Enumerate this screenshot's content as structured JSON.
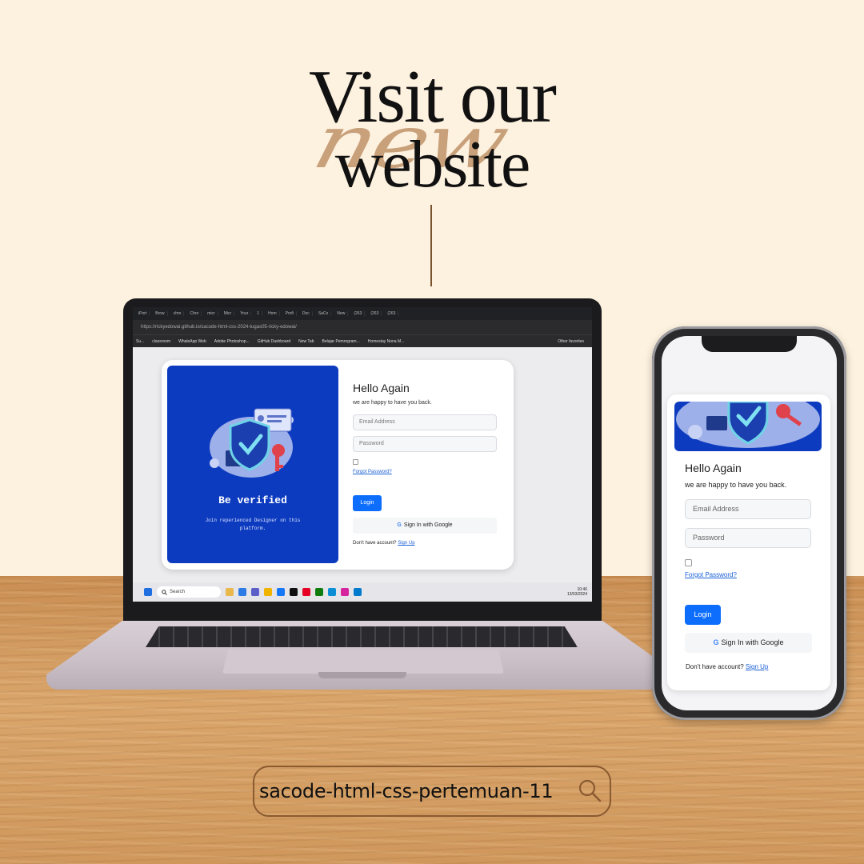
{
  "headline": {
    "script_word": "new",
    "line1": "Visit our",
    "line2": "website"
  },
  "browser": {
    "tabs": [
      "iPort",
      "Brow",
      "chro",
      "Chro",
      "micr",
      "Micr",
      "Your",
      "1",
      "Hom",
      "Profi",
      "Doc",
      "SaCo",
      "New",
      "(263",
      "(263",
      "(263"
    ],
    "url": "https://rickyedowai.github.io/sacode-html-css-2024-tugas05-ricky-edowai/",
    "bookmarks": [
      "Su...",
      "classroom",
      "WhatsApp Web",
      "Adobe Photoshop...",
      "GitHub Dashboard",
      "New Tab",
      "Belajar Pemrogram...",
      "Homestay Nona M..."
    ],
    "other_favorites": "Other favorites"
  },
  "taskbar": {
    "search": "Search",
    "time": "10:46",
    "date": "13/03/2024"
  },
  "laptop_card": {
    "panel_title": "Be verified",
    "panel_text": "Join reperienced Designer on this platform.",
    "title": "Hello Again",
    "subtitle": "we are happy to have you back.",
    "email_placeholder": "Email Address",
    "password_placeholder": "Password",
    "forgot": "Forgot Password?",
    "login": "Login",
    "google": "Sign In with Google",
    "no_account": "Don't have account?",
    "signup": "Sign Up"
  },
  "phone_card": {
    "title": "Hello Again",
    "subtitle": "we are happy to have you back.",
    "email_placeholder": "Email Address",
    "password_placeholder": "Password",
    "forgot": "Forgot Password?",
    "login": "Login",
    "google": "Sign In with Google",
    "no_account": "Don't have account?",
    "signup": "Sign Up"
  },
  "search_pill": {
    "text": "sacode-html-css-pertemuan-11"
  },
  "colors": {
    "background": "#fdf1df",
    "brand_blue": "#0d3bbf",
    "button_blue": "#0d6efd",
    "accent_brown": "#8a5a30"
  }
}
